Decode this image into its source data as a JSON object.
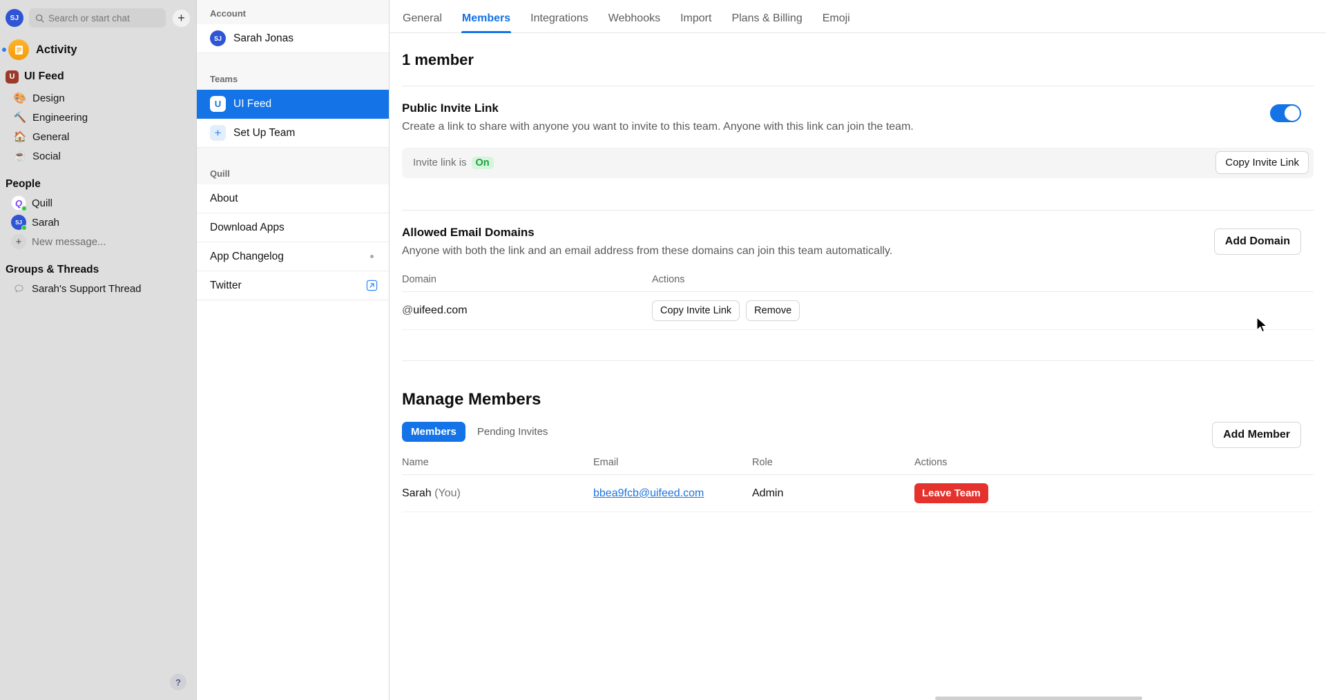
{
  "sidebar": {
    "user_initials": "SJ",
    "search_placeholder": "Search or start chat",
    "new_chat_icon": "plus-icon",
    "activity": {
      "label": "Activity",
      "icon": "activity-icon",
      "has_unread": true
    },
    "team": {
      "name": "UI Feed",
      "badge": "U"
    },
    "channels": [
      {
        "label": "Design",
        "emoji": "🎨"
      },
      {
        "label": "Engineering",
        "emoji": "🔨"
      },
      {
        "label": "General",
        "emoji": "🏠"
      },
      {
        "label": "Social",
        "emoji": "☕"
      }
    ],
    "people_title": "People",
    "people": [
      {
        "label": "Quill",
        "avatar_text": "Q",
        "status": "online"
      },
      {
        "label": "Sarah",
        "avatar_text": "SJ",
        "status": "online"
      }
    ],
    "new_message": "New message...",
    "groups_title": "Groups & Threads",
    "threads": [
      {
        "label": "Sarah's Support Thread",
        "icon": "chat-bubble-icon"
      }
    ],
    "help_label": "?"
  },
  "panel2": {
    "account_title": "Account",
    "account_name": "Sarah Jonas",
    "account_initials": "SJ",
    "teams_title": "Teams",
    "teams": [
      {
        "label": "UI Feed",
        "badge": "U",
        "selected": true
      },
      {
        "label": "Set Up Team",
        "badge": "+",
        "selected": false
      }
    ],
    "quill_title": "Quill",
    "quill_items": [
      {
        "label": "About",
        "dot": false,
        "external": false
      },
      {
        "label": "Download Apps",
        "dot": false,
        "external": false
      },
      {
        "label": "App Changelog",
        "dot": true,
        "external": false
      },
      {
        "label": "Twitter",
        "dot": false,
        "external": true
      }
    ]
  },
  "main": {
    "tabs": [
      {
        "label": "General",
        "active": false
      },
      {
        "label": "Members",
        "active": true
      },
      {
        "label": "Integrations",
        "active": false
      },
      {
        "label": "Webhooks",
        "active": false
      },
      {
        "label": "Import",
        "active": false
      },
      {
        "label": "Plans & Billing",
        "active": false
      },
      {
        "label": "Emoji",
        "active": false
      }
    ],
    "member_count_heading": "1 member",
    "public_invite": {
      "title": "Public Invite Link",
      "description": "Create a link to share with anyone you want to invite to this team. Anyone with this link can join the team.",
      "toggle_on": true,
      "status_prefix": "Invite link is",
      "status_value": "On",
      "copy_button": "Copy Invite Link"
    },
    "allowed_domains": {
      "title": "Allowed Email Domains",
      "description": "Anyone with both the link and an email address from these domains can join this team automatically.",
      "add_button": "Add Domain",
      "columns": [
        "Domain",
        "Actions"
      ],
      "rows": [
        {
          "domain_prefix": "@",
          "domain": "uifeed.com",
          "actions": [
            "Copy Invite Link",
            "Remove"
          ]
        }
      ]
    },
    "manage_members": {
      "title": "Manage Members",
      "segments": [
        {
          "label": "Members",
          "active": true
        },
        {
          "label": "Pending Invites",
          "active": false
        }
      ],
      "add_button": "Add Member",
      "columns": [
        "Name",
        "Email",
        "Role",
        "Actions"
      ],
      "rows": [
        {
          "name": "Sarah",
          "name_suffix": "(You)",
          "email": "bbea9fcb@uifeed.com",
          "role": "Admin",
          "action": "Leave Team"
        }
      ]
    }
  },
  "colors": {
    "accent": "#1473e6",
    "danger": "#e5322d",
    "success": "#18a33a",
    "sidebar_bg": "#dedede"
  }
}
